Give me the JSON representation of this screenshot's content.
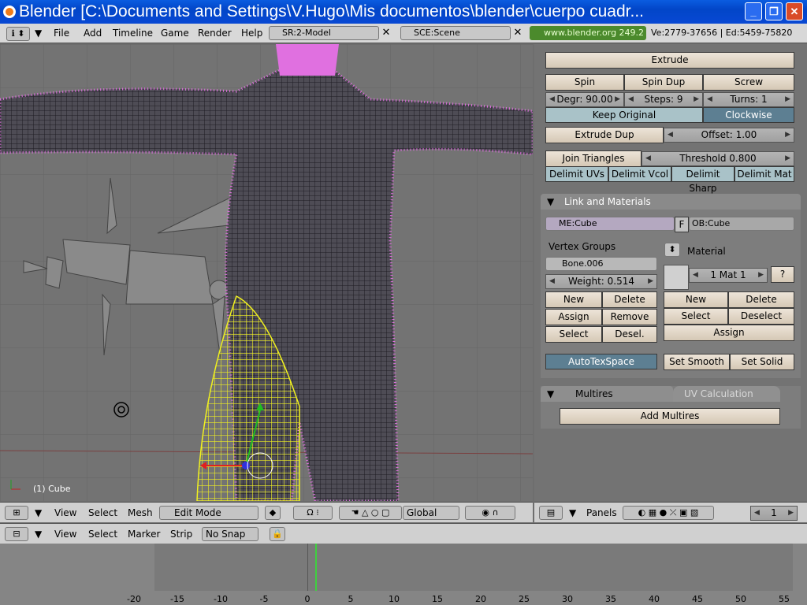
{
  "window": {
    "title": "Blender [C:\\Documents and Settings\\V.Hugo\\Mis documentos\\blender\\cuerpo cuadr...",
    "minimize": "_",
    "maximize": "❐",
    "close": "✕"
  },
  "topbar": {
    "menus": [
      "File",
      "Add",
      "Timeline",
      "Game",
      "Render",
      "Help"
    ],
    "screen_field": "SR:2-Model",
    "scene_field": "SCE:Scene",
    "blender_org": "www.blender.org 249.2",
    "stats": "Ve:2779-37656 | Ed:5459-75820"
  },
  "viewport": {
    "object_label": "(1) Cube",
    "header": {
      "menus": [
        "View",
        "Select",
        "Mesh"
      ],
      "mode": "Edit Mode",
      "orientation": "Global"
    }
  },
  "mesh_tools": {
    "extrude": "Extrude",
    "spin": "Spin",
    "spin_dup": "Spin Dup",
    "screw": "Screw",
    "degr": "Degr: 90.00",
    "steps": "Steps: 9",
    "turns": "Turns: 1",
    "keep_original": "Keep Original",
    "clockwise": "Clockwise",
    "extrude_dup": "Extrude Dup",
    "offset": "Offset: 1.00",
    "join_triangles": "Join Triangles",
    "threshold": "Threshold 0.800",
    "delimit": [
      "Delimit UVs",
      "Delimit Vcol",
      "Delimit Sharp",
      "Delimit Mat"
    ]
  },
  "link_materials": {
    "header": "Link and Materials",
    "mesh_name": "ME:Cube",
    "f_toggle": "F",
    "ob_name": "OB:Cube",
    "vertex_groups_label": "Vertex Groups",
    "group_name": "Bone.006",
    "weight": "Weight: 0.514",
    "vg_buttons": [
      "New",
      "Delete",
      "Assign",
      "Remove",
      "Select",
      "Desel."
    ],
    "material_label": "Material",
    "mat_index": "1 Mat 1",
    "mat_help": "?",
    "mat_buttons": [
      "New",
      "Delete",
      "Select",
      "Deselect"
    ],
    "mat_assign": "Assign",
    "autotexspace": "AutoTexSpace",
    "set_smooth": "Set Smooth",
    "set_solid": "Set Solid"
  },
  "multires": {
    "tab_active": "Multires",
    "tab_inactive": "UV Calculation",
    "add_button": "Add Multires"
  },
  "props_bar": {
    "panels_label": "Panels",
    "frame": "1"
  },
  "timeline": {
    "menus": [
      "View",
      "Select",
      "Marker",
      "Strip"
    ],
    "snap": "No Snap",
    "ticks": [
      "-20",
      "-15",
      "-10",
      "-5",
      "0",
      "5",
      "10",
      "15",
      "20",
      "25",
      "30",
      "35",
      "40",
      "45",
      "50",
      "55"
    ],
    "current_frame": 1
  },
  "colors": {
    "titlebar": "#0a5ce0",
    "selected_vertices": "#ff66ff",
    "selection_yellow": "#f0f020",
    "toggle_active": "#5d7f92"
  }
}
